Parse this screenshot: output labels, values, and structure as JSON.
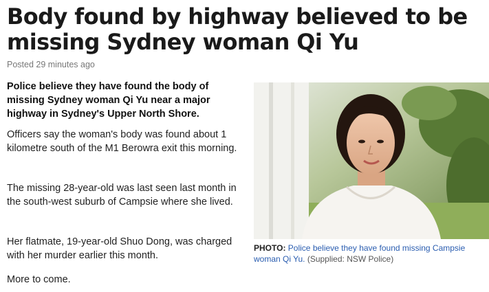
{
  "article": {
    "headline": "Body found by highway believed to be missing Sydney woman Qi Yu",
    "posted": "Posted 29 minutes ago",
    "lead": "Police believe they have found the body of missing Sydney woman Qi Yu near a major highway in Sydney's Upper North Shore.",
    "paragraphs": [
      "Officers say the woman's body was found about 1 kilometre south of the M1 Berowra exit this morning.",
      "The missing 28-year-old was last seen last month in the south-west suburb of Campsie where she lived.",
      "Her flatmate, 19-year-old Shuo Dong, was charged with her murder earlier this month.",
      "More to come."
    ]
  },
  "photo": {
    "caption_label": "PHOTO:",
    "caption_text": "Police believe they have found missing Campsie woman Qi Yu.",
    "caption_source": "(Supplied: NSW Police)"
  }
}
